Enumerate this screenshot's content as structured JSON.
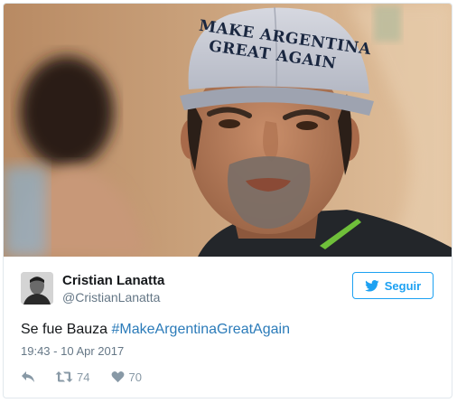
{
  "media": {
    "hat_line1": "MAKE ARGENTINA",
    "hat_line2": "GREAT AGAIN"
  },
  "author": {
    "display_name": "Cristian Lanatta",
    "handle": "@CristianLanatta"
  },
  "follow_button": {
    "label": "Seguir",
    "icon": "twitter-bird-icon"
  },
  "tweet": {
    "text_prefix": "Se fue Bauza ",
    "hashtag": "#MakeArgentinaGreatAgain"
  },
  "timestamp": "19:43 - 10 Apr 2017",
  "actions": {
    "reply_icon": "reply-icon",
    "retweet_icon": "retweet-icon",
    "retweet_count": "74",
    "like_icon": "heart-icon",
    "like_count": "70"
  },
  "colors": {
    "accent": "#1da1f2",
    "hashtag": "#2b7bb9",
    "meta_text": "#657786",
    "action_icon": "#8899a6"
  }
}
